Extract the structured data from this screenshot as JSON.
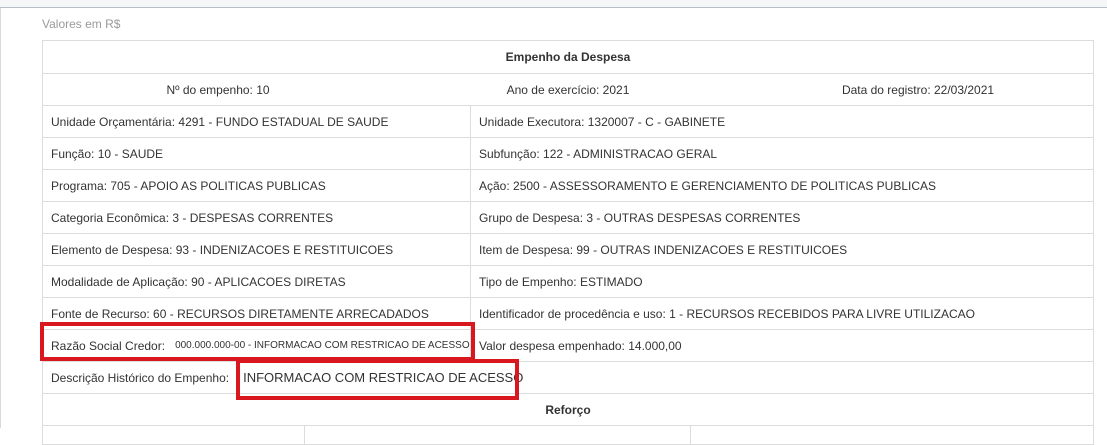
{
  "currency_note": "Valores em R$",
  "empenho": {
    "title": "Empenho da Despesa",
    "numero": "Nº do empenho: 10",
    "ano": "Ano de exercício: 2021",
    "data_registro": "Data do registro: 22/03/2021",
    "rows": [
      [
        "Unidade Orçamentária: 4291 - FUNDO ESTADUAL DE SAUDE",
        "Unidade Executora: 1320007 - C - GABINETE"
      ],
      [
        "Função: 10 - SAUDE",
        "Subfunção: 122 - ADMINISTRACAO GERAL"
      ],
      [
        "Programa: 705 - APOIO AS POLITICAS PUBLICAS",
        "Ação: 2500 - ASSESSORAMENTO E GERENCIAMENTO DE POLITICAS PUBLICAS"
      ],
      [
        "Categoria Econômica: 3 - DESPESAS CORRENTES",
        "Grupo de Despesa: 3 - OUTRAS DESPESAS CORRENTES"
      ],
      [
        "Elemento de Despesa: 93 - INDENIZACOES E RESTITUICOES",
        "Item de Despesa: 99 - OUTRAS INDENIZACOES E RESTITUICOES"
      ],
      [
        "Modalidade de Aplicação: 90 - APLICACOES DIRETAS",
        "Tipo de Empenho: ESTIMADO"
      ],
      [
        "Fonte de Recurso: 60 - RECURSOS DIRETAMENTE ARRECADADOS",
        "Identificador de procedência e uso: 1 - RECURSOS RECEBIDOS PARA LIVRE UTILIZACAO"
      ]
    ],
    "credor_label": "Razão Social Credor:",
    "credor_value": "000.000.000-00 - INFORMACAO COM RESTRICAO DE ACESSO",
    "valor_empenhado": "Valor despesa empenhado: 14.000,00",
    "historico_label": "Descrição Histórico do Empenho:",
    "historico_value": "INFORMACAO COM RESTRICAO DE ACESSO"
  },
  "reforco": {
    "title": "Reforço"
  },
  "colors": {
    "highlight": "#d9171e",
    "border": "#dcdcdc"
  }
}
